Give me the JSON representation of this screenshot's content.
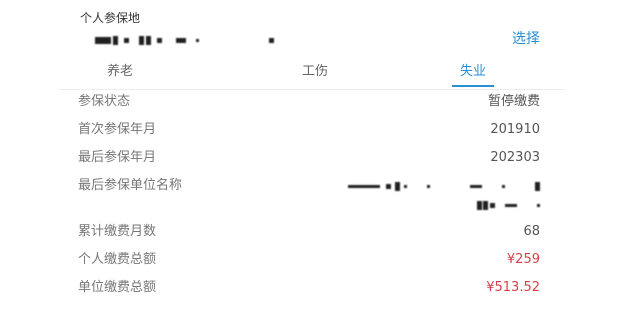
{
  "header": {
    "title": "个人参保地",
    "select_label": "选择"
  },
  "tabs": [
    {
      "label": "养老",
      "active": false
    },
    {
      "label": "工伤",
      "active": false
    },
    {
      "label": "失业",
      "active": true
    }
  ],
  "rows": [
    {
      "label": "参保状态",
      "value": "暂停缴费"
    },
    {
      "label": "首次参保年月",
      "value": "201910"
    },
    {
      "label": "最后参保年月",
      "value": "202303"
    },
    {
      "label": "最后参保单位名称"
    },
    {
      "label": "累计缴费月数",
      "value": "68"
    },
    {
      "label": "个人缴费总额",
      "value": "¥259"
    },
    {
      "label": "单位缴费总额",
      "value": "¥513.52"
    }
  ],
  "colors": {
    "accent": "#2b8fd3",
    "amount": "#d6404a",
    "label": "#777777",
    "value": "#555555"
  }
}
